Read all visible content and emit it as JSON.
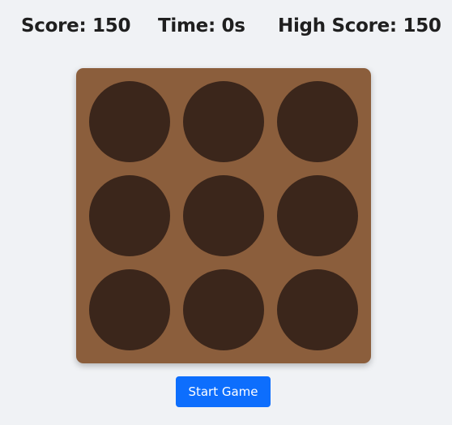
{
  "stats": {
    "score": "Score: 150",
    "time": "Time: 0s",
    "high_score": "High Score: 150"
  },
  "board": {
    "rows": 3,
    "columns": 3,
    "hole_color": "#3b261b",
    "board_color": "#8b5e3c"
  },
  "controls": {
    "start_label": "Start Game",
    "accent_color": "#0d6efd"
  }
}
